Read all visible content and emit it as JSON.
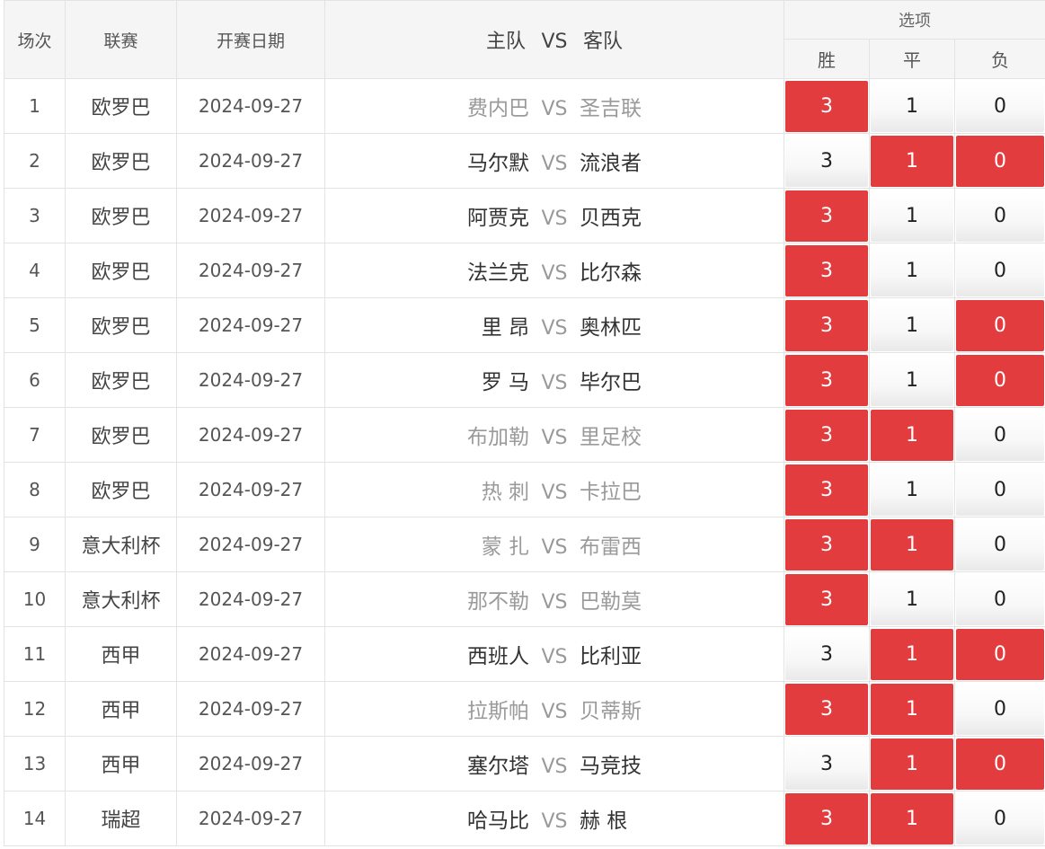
{
  "header": {
    "index": "场次",
    "league": "联赛",
    "date": "开赛日期",
    "home": "主队",
    "vs": "VS",
    "away": "客队",
    "options": "选项",
    "win": "胜",
    "draw": "平",
    "lose": "负"
  },
  "colors": {
    "selected": "#e23c3f",
    "muted_team": "#9a9a9a"
  },
  "rows": [
    {
      "index": "1",
      "league": "欧罗巴",
      "date": "2024-09-27",
      "home": "费内巴",
      "away": "圣吉联",
      "vs": "VS",
      "teams_muted": true,
      "win": "3",
      "draw": "1",
      "lose": "0",
      "sel_win": true,
      "sel_draw": false,
      "sel_lose": false
    },
    {
      "index": "2",
      "league": "欧罗巴",
      "date": "2024-09-27",
      "home": "马尔默",
      "away": "流浪者",
      "vs": "VS",
      "teams_muted": false,
      "win": "3",
      "draw": "1",
      "lose": "0",
      "sel_win": false,
      "sel_draw": true,
      "sel_lose": true
    },
    {
      "index": "3",
      "league": "欧罗巴",
      "date": "2024-09-27",
      "home": "阿贾克",
      "away": "贝西克",
      "vs": "VS",
      "teams_muted": false,
      "win": "3",
      "draw": "1",
      "lose": "0",
      "sel_win": true,
      "sel_draw": false,
      "sel_lose": false
    },
    {
      "index": "4",
      "league": "欧罗巴",
      "date": "2024-09-27",
      "home": "法兰克",
      "away": "比尔森",
      "vs": "VS",
      "teams_muted": false,
      "win": "3",
      "draw": "1",
      "lose": "0",
      "sel_win": true,
      "sel_draw": false,
      "sel_lose": false
    },
    {
      "index": "5",
      "league": "欧罗巴",
      "date": "2024-09-27",
      "home": "里 昂",
      "away": "奥林匹",
      "vs": "VS",
      "teams_muted": false,
      "win": "3",
      "draw": "1",
      "lose": "0",
      "sel_win": true,
      "sel_draw": false,
      "sel_lose": true
    },
    {
      "index": "6",
      "league": "欧罗巴",
      "date": "2024-09-27",
      "home": "罗 马",
      "away": "毕尔巴",
      "vs": "VS",
      "teams_muted": false,
      "win": "3",
      "draw": "1",
      "lose": "0",
      "sel_win": true,
      "sel_draw": false,
      "sel_lose": true
    },
    {
      "index": "7",
      "league": "欧罗巴",
      "date": "2024-09-27",
      "home": "布加勒",
      "away": "里足校",
      "vs": "VS",
      "teams_muted": true,
      "win": "3",
      "draw": "1",
      "lose": "0",
      "sel_win": true,
      "sel_draw": true,
      "sel_lose": false
    },
    {
      "index": "8",
      "league": "欧罗巴",
      "date": "2024-09-27",
      "home": "热 刺",
      "away": "卡拉巴",
      "vs": "VS",
      "teams_muted": true,
      "win": "3",
      "draw": "1",
      "lose": "0",
      "sel_win": true,
      "sel_draw": false,
      "sel_lose": false
    },
    {
      "index": "9",
      "league": "意大利杯",
      "date": "2024-09-27",
      "home": "蒙 扎",
      "away": "布雷西",
      "vs": "VS",
      "teams_muted": true,
      "win": "3",
      "draw": "1",
      "lose": "0",
      "sel_win": true,
      "sel_draw": true,
      "sel_lose": false
    },
    {
      "index": "10",
      "league": "意大利杯",
      "date": "2024-09-27",
      "home": "那不勒",
      "away": "巴勒莫",
      "vs": "VS",
      "teams_muted": true,
      "win": "3",
      "draw": "1",
      "lose": "0",
      "sel_win": true,
      "sel_draw": false,
      "sel_lose": false
    },
    {
      "index": "11",
      "league": "西甲",
      "date": "2024-09-27",
      "home": "西班人",
      "away": "比利亚",
      "vs": "VS",
      "teams_muted": false,
      "win": "3",
      "draw": "1",
      "lose": "0",
      "sel_win": false,
      "sel_draw": true,
      "sel_lose": true
    },
    {
      "index": "12",
      "league": "西甲",
      "date": "2024-09-27",
      "home": "拉斯帕",
      "away": "贝蒂斯",
      "vs": "VS",
      "teams_muted": true,
      "win": "3",
      "draw": "1",
      "lose": "0",
      "sel_win": true,
      "sel_draw": true,
      "sel_lose": false
    },
    {
      "index": "13",
      "league": "西甲",
      "date": "2024-09-27",
      "home": "塞尔塔",
      "away": "马竞技",
      "vs": "VS",
      "teams_muted": false,
      "win": "3",
      "draw": "1",
      "lose": "0",
      "sel_win": false,
      "sel_draw": true,
      "sel_lose": true
    },
    {
      "index": "14",
      "league": "瑞超",
      "date": "2024-09-27",
      "home": "哈马比",
      "away": "赫 根",
      "vs": "VS",
      "teams_muted": false,
      "win": "3",
      "draw": "1",
      "lose": "0",
      "sel_win": true,
      "sel_draw": true,
      "sel_lose": false
    }
  ]
}
